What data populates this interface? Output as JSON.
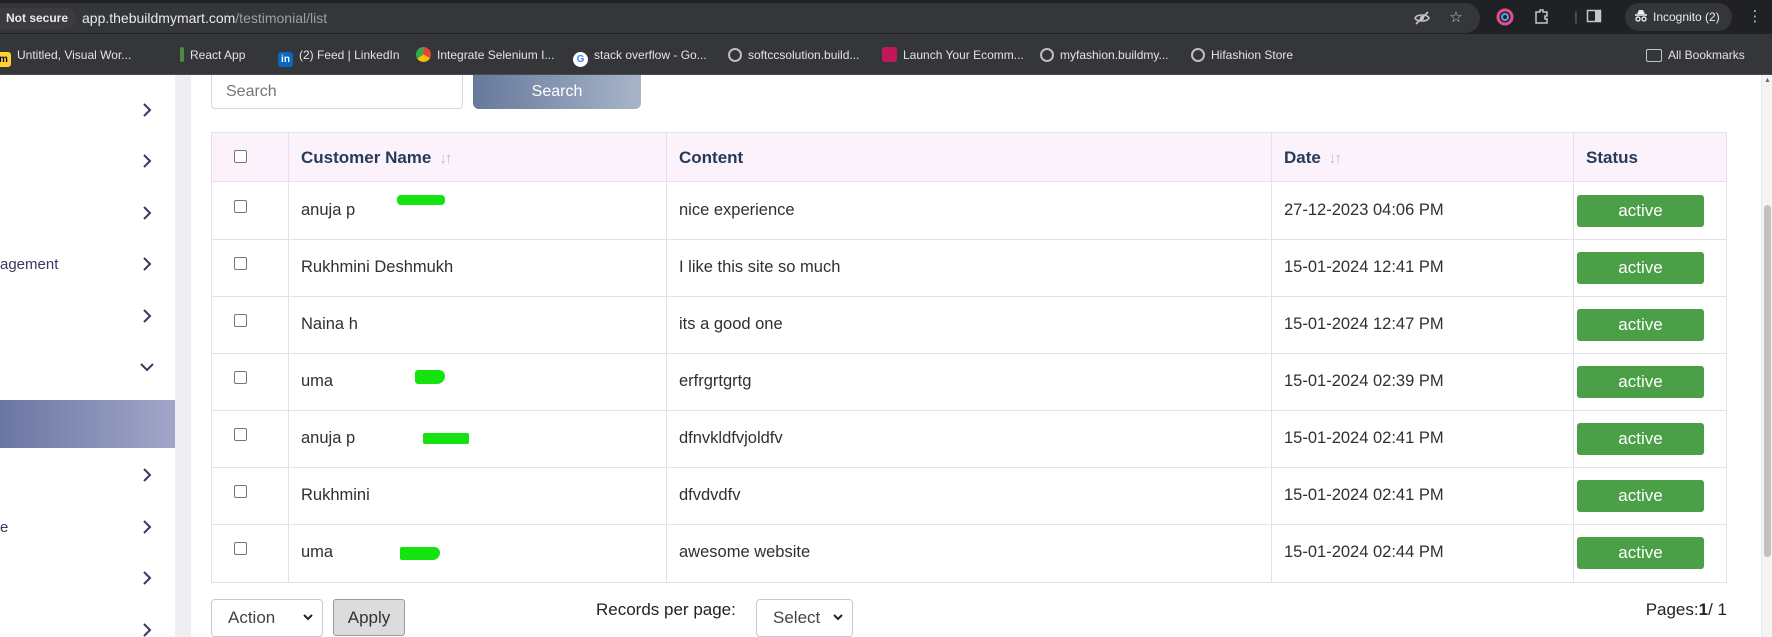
{
  "browser": {
    "security_label": "Not secure",
    "url_host": "app.thebuildmymart.com",
    "url_path": "/testimonial/list",
    "incognito_label": "Incognito (2)",
    "bookmarks": [
      {
        "label": "Untitled, Visual Wor...",
        "icon": "miro-icon",
        "color": "#ffd02f"
      },
      {
        "label": "React App",
        "icon": "react-icon",
        "color": "#4b8b3b"
      },
      {
        "label": "(2) Feed | LinkedIn",
        "icon": "linkedin-icon",
        "color": "#0a66c2"
      },
      {
        "label": "Integrate Selenium I...",
        "icon": "chrome-icon",
        "color": "#f4b400"
      },
      {
        "label": "stack overflow - Go...",
        "icon": "google-icon",
        "color": "#ffffff"
      },
      {
        "label": "softccsolution.build...",
        "icon": "globe-icon",
        "color": "#bdbdbd"
      },
      {
        "label": "Launch Your Ecomm...",
        "icon": "store-icon",
        "color": "#c2185b"
      },
      {
        "label": "myfashion.buildmy...",
        "icon": "globe-icon",
        "color": "#bdbdbd"
      },
      {
        "label": "Hifashion Store",
        "icon": "globe-icon",
        "color": "#bdbdbd"
      }
    ],
    "all_bookmarks_label": "All Bookmarks"
  },
  "sidebar": {
    "items": [
      {
        "label": ""
      },
      {
        "label": ""
      },
      {
        "label": ""
      },
      {
        "label": "agement"
      },
      {
        "label": ""
      },
      {
        "label": "",
        "expanded": true
      },
      {
        "label": ""
      },
      {
        "label": "e"
      },
      {
        "label": ""
      },
      {
        "label": ""
      }
    ]
  },
  "search": {
    "placeholder": "Search",
    "button_label": "Search"
  },
  "table": {
    "columns": {
      "customer_name": "Customer Name",
      "content": "Content",
      "date": "Date",
      "status": "Status"
    },
    "rows": [
      {
        "name": "anuja p",
        "content": "nice experience",
        "date": "27-12-2023 04:06 PM",
        "status": "active"
      },
      {
        "name": "Rukhmini Deshmukh",
        "content": "I like this site so much",
        "date": "15-01-2024 12:41 PM",
        "status": "active"
      },
      {
        "name": "Naina h",
        "content": "its a good one",
        "date": "15-01-2024 12:47 PM",
        "status": "active"
      },
      {
        "name": "uma",
        "content": "erfrgrtgrtg",
        "date": "15-01-2024 02:39 PM",
        "status": "active"
      },
      {
        "name": "anuja p",
        "content": "dfnvkldfvjoldfv",
        "date": "15-01-2024 02:41 PM",
        "status": "active"
      },
      {
        "name": "Rukhmini",
        "content": "dfvdvdfv",
        "date": "15-01-2024 02:41 PM",
        "status": "active"
      },
      {
        "name": "uma",
        "content": "awesome website",
        "date": "15-01-2024 02:44 PM",
        "status": "active"
      }
    ]
  },
  "footer": {
    "action_label": "Action",
    "apply_label": "Apply",
    "records_per_page_label": "Records per page:",
    "records_select_label": "Select",
    "pages_prefix": "Pages:",
    "current_page": "1",
    "total_pages": "/ 1"
  },
  "colors": {
    "status_active": "#4a9f47",
    "header_bg": "#fbf2fb",
    "annotation_mark": "#15e30f"
  }
}
